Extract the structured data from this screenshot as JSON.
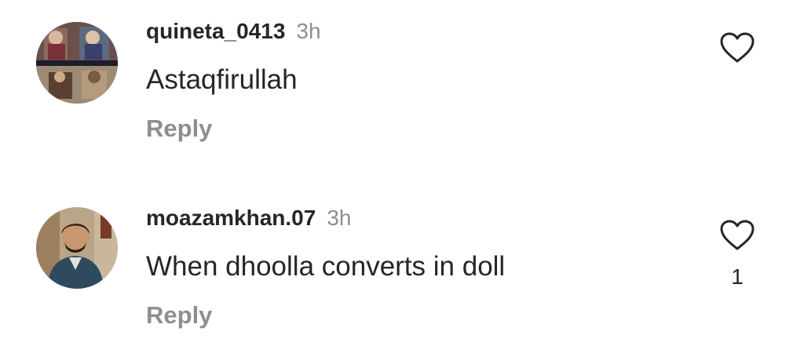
{
  "comments": [
    {
      "username": "quineta_0413",
      "time": "3h",
      "text": "Astaqfirullah",
      "reply_label": "Reply",
      "like_count": ""
    },
    {
      "username": "moazamkhan.07",
      "time": "3h",
      "text": "When dhoolla converts in doll",
      "reply_label": "Reply",
      "like_count": "1"
    }
  ],
  "icons": {
    "like": "heart-outline-icon"
  },
  "colors": {
    "primary_text": "#262626",
    "secondary_text": "#8e8e8e",
    "background": "#ffffff"
  }
}
